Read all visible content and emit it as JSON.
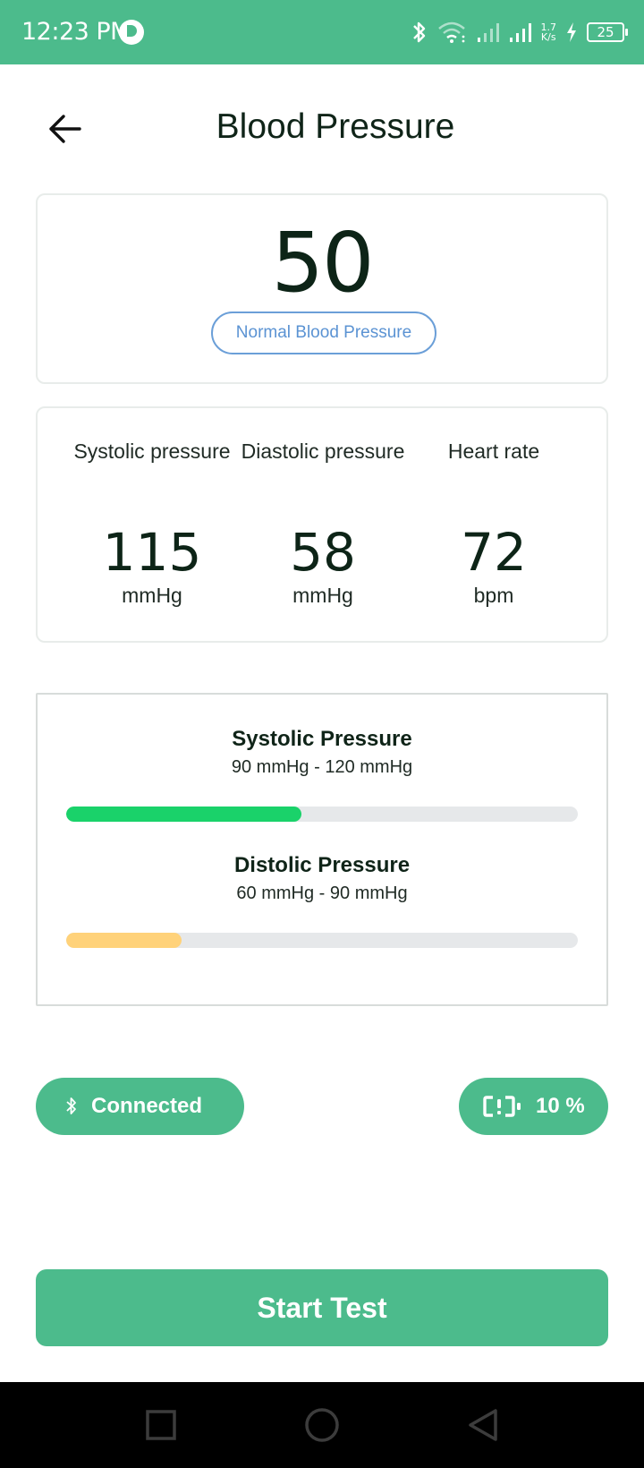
{
  "status_bar": {
    "time": "12:23 PM",
    "net_speed_value": "1.7",
    "net_speed_unit": "K/s",
    "battery_level": "25",
    "icons": [
      "app-icon",
      "bluetooth-icon",
      "wifi-icon",
      "signal-icon",
      "signal-icon",
      "charging-icon",
      "battery-icon"
    ]
  },
  "header": {
    "back_icon": "arrow-left-icon",
    "title": "Blood Pressure"
  },
  "score": {
    "value": "50",
    "status": "Normal Blood Pressure"
  },
  "metrics": [
    {
      "label": "Systolic pressure",
      "value": "115",
      "unit": "mmHg"
    },
    {
      "label": "Diastolic pressure",
      "value": "58",
      "unit": "mmHg"
    },
    {
      "label": "Heart rate",
      "value": "72",
      "unit": "bpm"
    }
  ],
  "ranges": [
    {
      "title": "Systolic Pressure",
      "range": "90 mmHg - 120 mmHg",
      "progress": 0.46,
      "color": "#1ad26a"
    },
    {
      "title": "Distolic Pressure",
      "range": "60 mmHg - 90 mmHg",
      "progress": 0.225,
      "color": "#ffd27a"
    }
  ],
  "device": {
    "connection_icon": "bluetooth-icon",
    "connection_label": "Connected",
    "battery_icon": "low-battery-icon",
    "battery_label": "10 %"
  },
  "actions": {
    "start_label": "Start Test"
  },
  "nav": {
    "icons": [
      "recents-square-icon",
      "home-circle-icon",
      "back-triangle-icon"
    ]
  },
  "colors": {
    "brand": "#4cbb8c",
    "status_outline": "#6b9fd8"
  }
}
